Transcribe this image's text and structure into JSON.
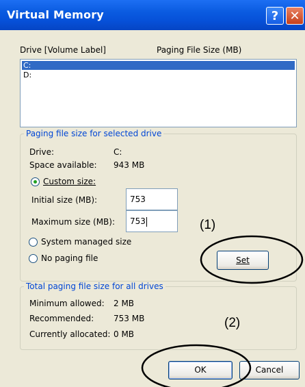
{
  "window": {
    "title": "Virtual Memory"
  },
  "titlebar_buttons": {
    "help": "?",
    "close": "✕"
  },
  "list": {
    "header_drive": "Drive  [Volume Label]",
    "header_size": "Paging File Size (MB)",
    "items": [
      {
        "drive": "C:",
        "selected": true
      },
      {
        "drive": "D:",
        "selected": false
      }
    ]
  },
  "selected_drive_group": {
    "legend": "Paging file size for selected drive",
    "drive_label": "Drive:",
    "drive_value": "C:",
    "space_label": "Space available:",
    "space_value": "943 MB",
    "custom_size_label": "Custom size:",
    "initial_label": "Initial size (MB):",
    "initial_value": "753",
    "maximum_label": "Maximum size (MB):",
    "maximum_value": "753",
    "system_managed_label": "System managed size",
    "no_paging_label": "No paging file",
    "set_button": "Set",
    "selected_option": "custom"
  },
  "all_drives_group": {
    "legend": "Total paging file size for all drives",
    "minimum_label": "Minimum allowed:",
    "minimum_value": "2 MB",
    "recommended_label": "Recommended:",
    "recommended_value": "753 MB",
    "allocated_label": "Currently allocated:",
    "allocated_value": "0 MB"
  },
  "buttons": {
    "ok": "OK",
    "cancel": "Cancel"
  },
  "annotations": {
    "step1": "(1)",
    "step2": "(2)"
  },
  "colors": {
    "titlebar": "#0a5be0",
    "selection": "#316ac5",
    "legend_text": "#0046d5",
    "dialog_bg": "#ece9d8"
  }
}
